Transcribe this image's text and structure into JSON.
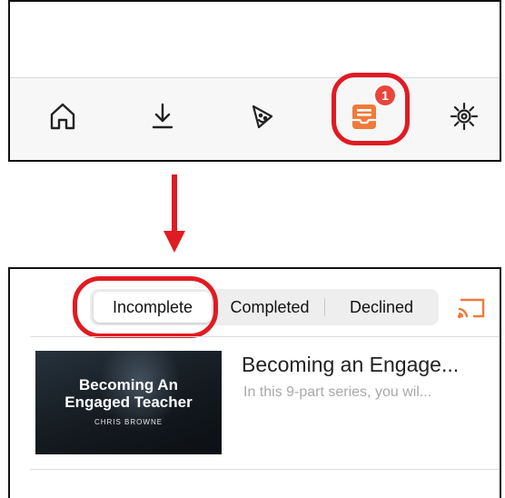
{
  "tab_bar": {
    "tabs": [
      {
        "name": "home",
        "icon": "home-icon"
      },
      {
        "name": "downloads",
        "icon": "download-icon"
      },
      {
        "name": "kids",
        "icon": "party-hat-icon"
      },
      {
        "name": "assignments",
        "icon": "assignment-tray-icon",
        "badge": "1",
        "selected": true
      },
      {
        "name": "settings",
        "icon": "gear-icon"
      }
    ],
    "badge_count": "1",
    "accent_color": "#f07a3a",
    "badge_color": "#e8463d"
  },
  "annotation": {
    "ring_color": "#e01b22",
    "arrow_color": "#e01b22"
  },
  "segment_control": {
    "options": [
      "Incomplete",
      "Completed",
      "Declined"
    ],
    "selected": "Incomplete"
  },
  "cast_icon": "cast-icon",
  "list": {
    "items": [
      {
        "thumbnail_title": "Becoming An Engaged Teacher",
        "thumbnail_title_line1": "Becoming An",
        "thumbnail_title_line2": "Engaged Teacher",
        "thumbnail_author": "CHRIS BROWNE",
        "title": "Becoming an Engage...",
        "description": "In this 9-part series, you wil..."
      }
    ]
  }
}
